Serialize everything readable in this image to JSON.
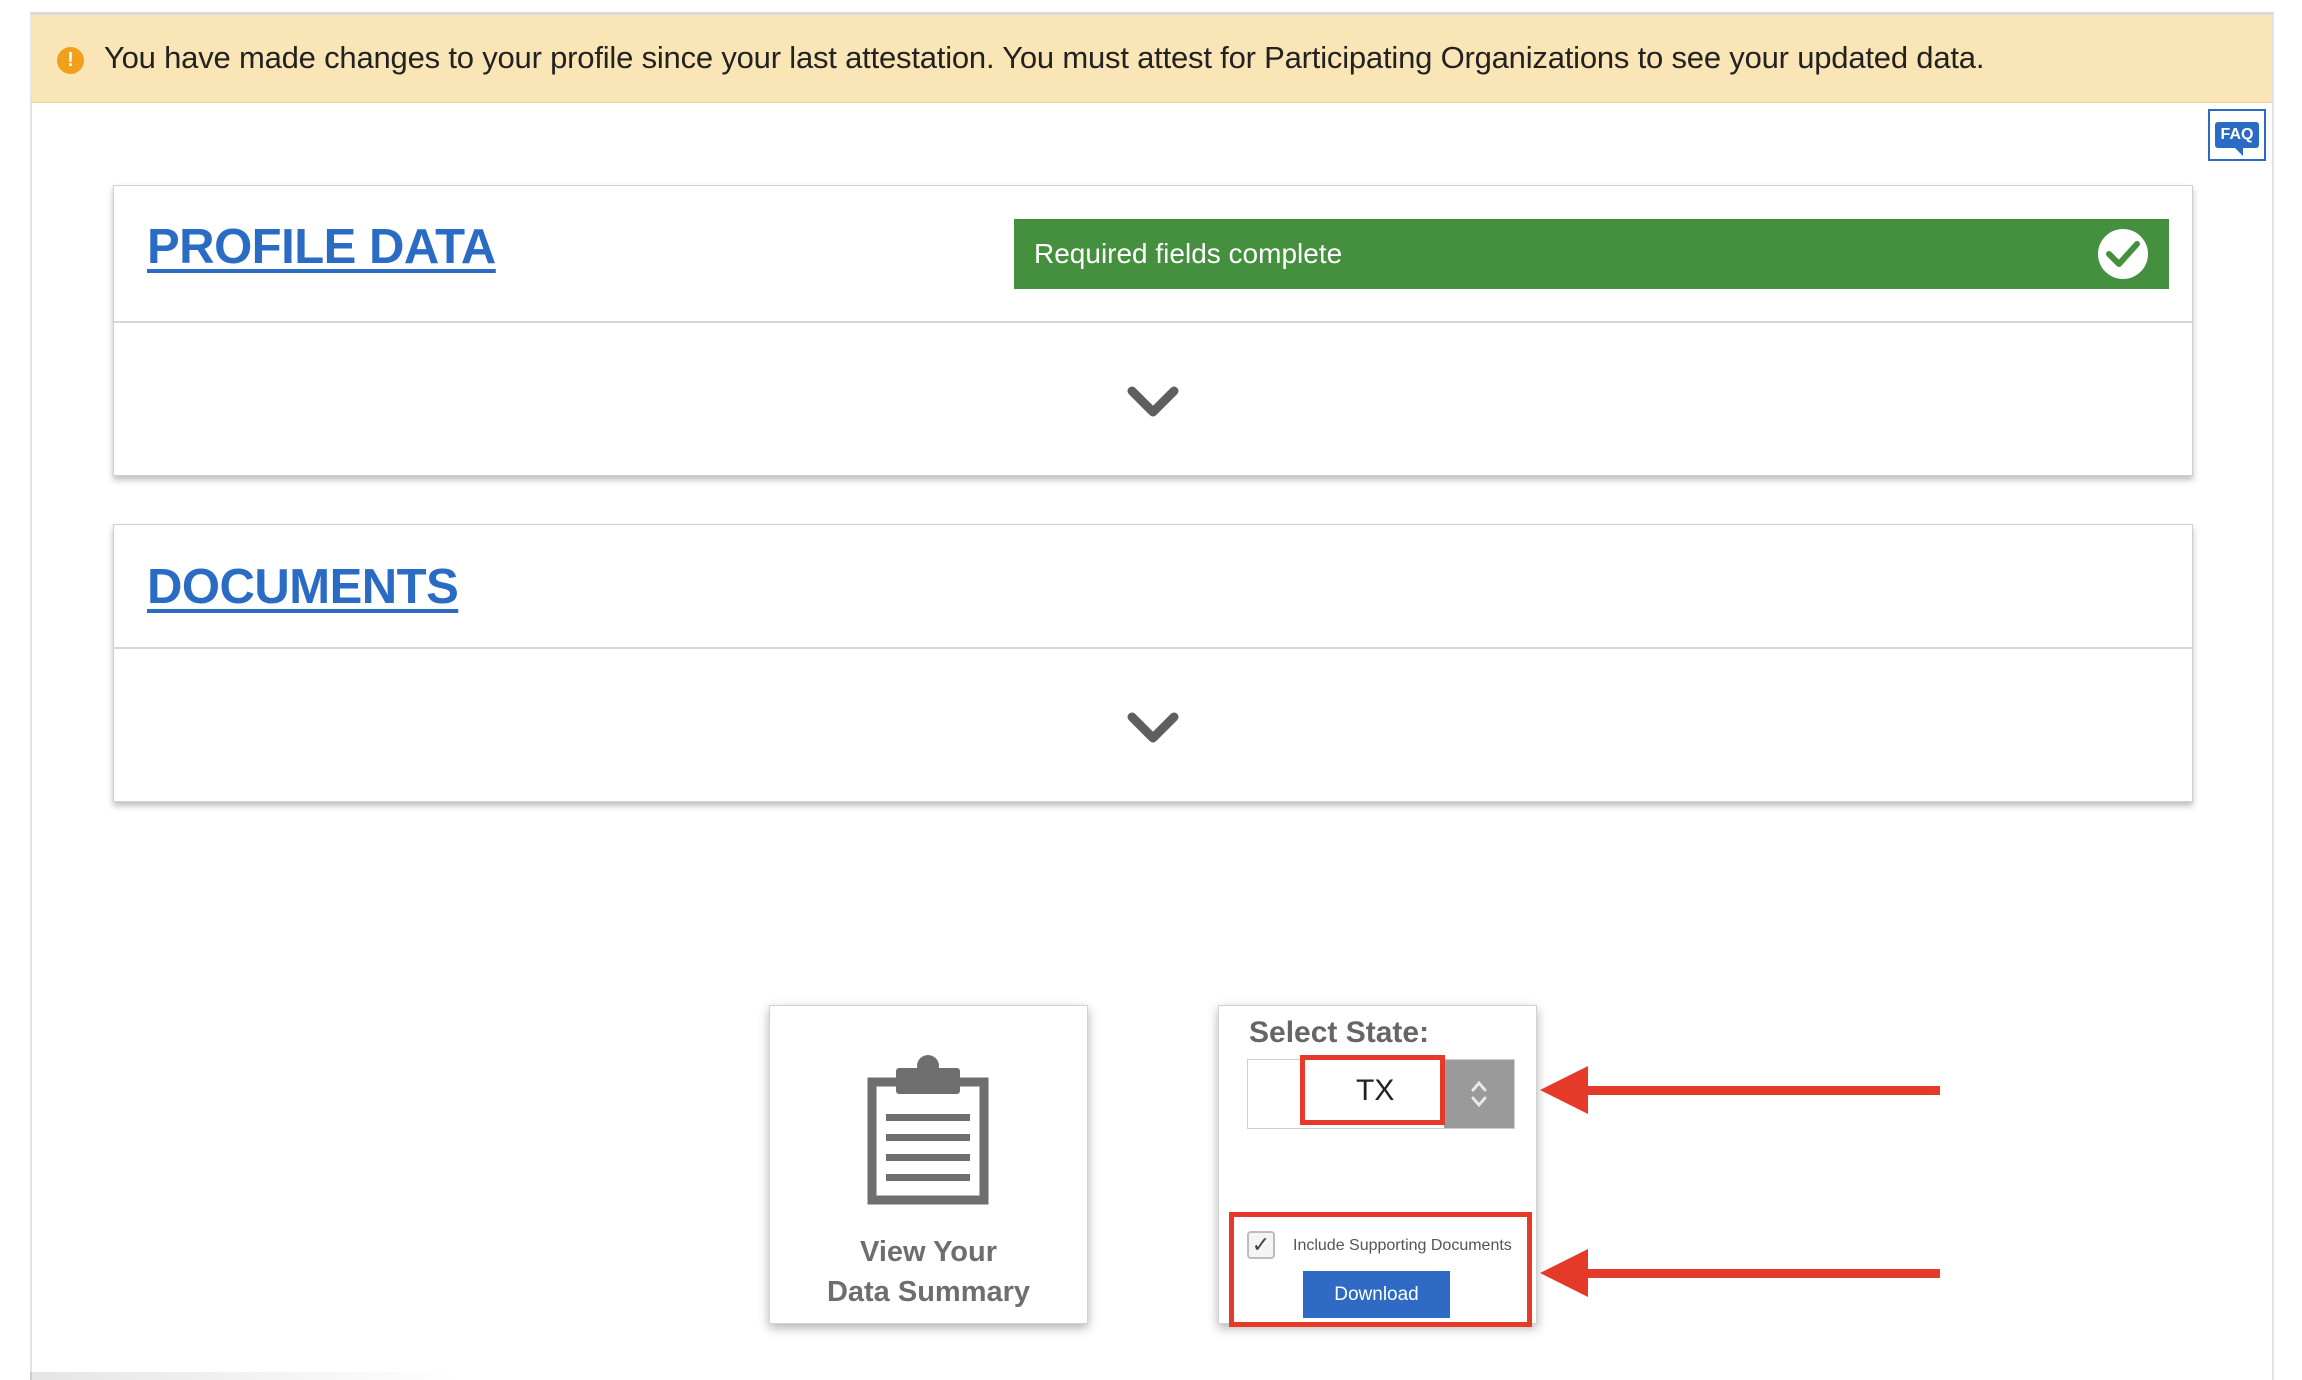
{
  "alert": {
    "icon": "exclamation-icon",
    "message": "You have made changes to your profile since your last attestation. You must attest for Participating Organizations to see your updated data."
  },
  "faq": {
    "label": "FAQ"
  },
  "profile": {
    "title": "PROFILE DATA",
    "status": "Required fields complete",
    "status_color": "#44903f"
  },
  "documents": {
    "title": "DOCUMENTS"
  },
  "summary_tile": {
    "icon": "clipboard-icon",
    "line1": "View Your",
    "line2": "Data Summary"
  },
  "download_tile": {
    "select_label": "Select State:",
    "state_value": "TX",
    "include_label": "Include Supporting Documents",
    "include_checked": true,
    "download_label": "Download"
  },
  "colors": {
    "accent": "#2a6bc4",
    "alert_bg": "#fae5b6",
    "annotation": "#e53a2a"
  }
}
